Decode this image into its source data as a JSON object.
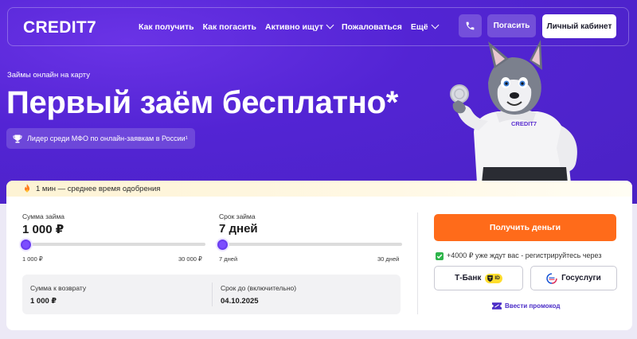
{
  "header": {
    "logo": "CREDIT7",
    "nav": [
      {
        "label": "Как получить",
        "has_dropdown": false
      },
      {
        "label": "Как погасить",
        "has_dropdown": false
      },
      {
        "label": "Активно ищут",
        "has_dropdown": true
      },
      {
        "label": "Пожаловаться",
        "has_dropdown": false
      },
      {
        "label": "Ещё",
        "has_dropdown": true
      }
    ],
    "phone_icon": "phone-icon",
    "repay_label": "Погасить",
    "cabinet_label": "Личный кабинет"
  },
  "hero": {
    "eyebrow": "Займы онлайн на карту",
    "title": "Первый заём бесплатно*",
    "leader_icon": "trophy-icon",
    "leader_text": "Лидер среди МФО по онлайн-заявкам в России¹",
    "mascot_shirt_text": "CREDIT7"
  },
  "calculator": {
    "approval_icon": "fire-icon",
    "approval_text": "1 мин — среднее время одобрения",
    "amount": {
      "label": "Сумма займа",
      "value": "1 000 ₽",
      "min_label": "1 000 ₽",
      "max_label": "30 000 ₽",
      "min": 1000,
      "max": 30000,
      "current": 1000
    },
    "term": {
      "label": "Срок займа",
      "value": "7 дней",
      "min_label": "7 дней",
      "max_label": "30 дней",
      "min": 7,
      "max": 30,
      "current": 7
    },
    "summary": {
      "return_label": "Сумма к возврату",
      "return_value": "1 000 ₽",
      "due_label": "Срок до (включительно)",
      "due_value": "04.10.2025"
    },
    "get_money_label": "Получить деньги",
    "bonus_text": "+4000 ₽ уже ждут вас - регистрируйтесь через",
    "tbank_label": "Т-Банк",
    "tbank_badge": "ID",
    "gosuslugi_label": "Госуслуги",
    "promo_label": "Ввести промокод",
    "colors": {
      "accent": "#ff6b1a",
      "brand": "#5324d4",
      "slider": "#7c4dff",
      "check": "#2db44a"
    }
  }
}
